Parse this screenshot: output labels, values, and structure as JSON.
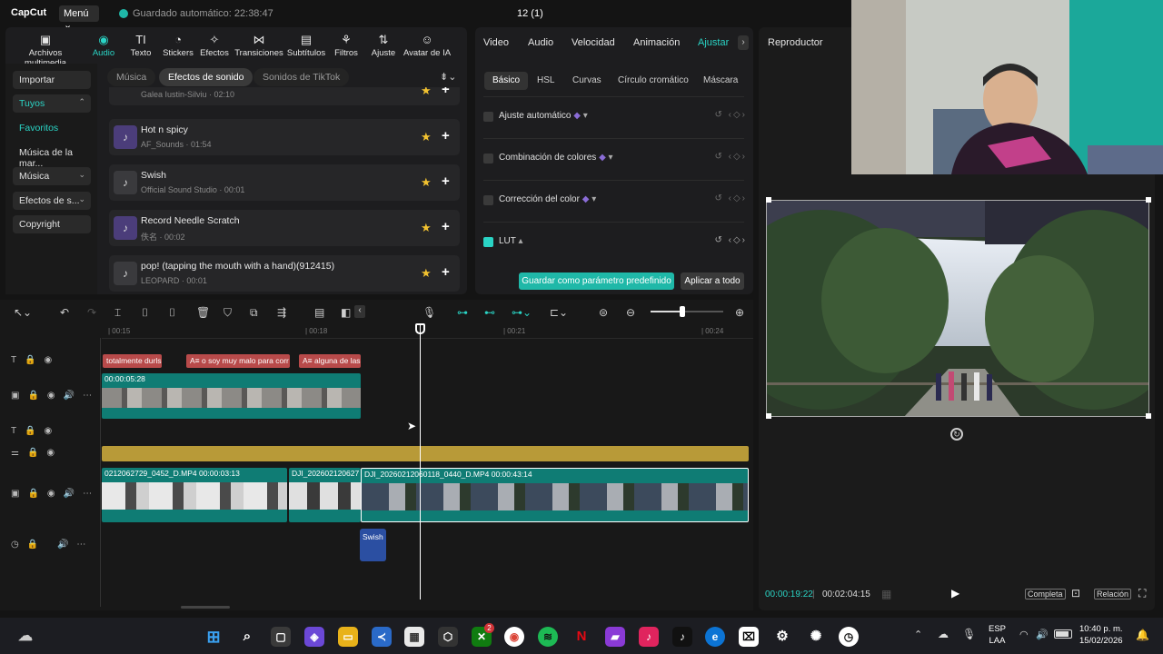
{
  "app": {
    "logo": "CapCut",
    "menu_label": "Menú ⌄",
    "autosave": "Guardado automático: 22:38:47",
    "project_title": "12 (1)"
  },
  "toolbar": [
    {
      "label": "Archivos multimedia",
      "icon": "media-icon"
    },
    {
      "label": "Audio",
      "icon": "audio-icon"
    },
    {
      "label": "Texto",
      "icon": "text-icon"
    },
    {
      "label": "Stickers",
      "icon": "sticker-icon"
    },
    {
      "label": "Efectos",
      "icon": "effects-icon"
    },
    {
      "label": "Transiciones",
      "icon": "transitions-icon"
    },
    {
      "label": "Subtítulos",
      "icon": "subtitles-icon"
    },
    {
      "label": "Filtros",
      "icon": "filters-icon"
    },
    {
      "label": "Ajuste",
      "icon": "adjust-icon"
    },
    {
      "label": "Avatar de IA",
      "icon": "ai-avatar-icon"
    }
  ],
  "categories": {
    "import": "Importar",
    "yours": "Tuyos",
    "favorites": "Favoritos",
    "brand_music": "Música de la mar...",
    "music": "Música",
    "sound_effects": "Efectos de s...",
    "copyright": "Copyright"
  },
  "subtabs": [
    "Música",
    "Efectos de sonido",
    "Sonidos de TikTok"
  ],
  "sounds": {
    "partial_sub": "Galea Iustin-Silviu · 02:10",
    "items": [
      {
        "name": "Hot n spicy",
        "sub": "AF_Sounds · 01:54"
      },
      {
        "name": "Swish",
        "sub": "Official Sound Studio · 00:01"
      },
      {
        "name": "Record Needle Scratch",
        "sub": "佚名 · 00:02"
      },
      {
        "name": "pop! (tapping the mouth with a hand)(912415)",
        "sub": "LEOPARD · 00:01"
      }
    ]
  },
  "adjust_panel": {
    "tabs": [
      "Video",
      "Audio",
      "Velocidad",
      "Animación",
      "Ajustar"
    ],
    "subtabs": [
      "Básico",
      "HSL",
      "Curvas",
      "Círculo cromático",
      "Máscara"
    ],
    "rows": [
      {
        "label": "Ajuste automático",
        "checked": false
      },
      {
        "label": "Combinación de colores",
        "checked": false
      },
      {
        "label": "Corrección del color",
        "checked": false
      },
      {
        "label": "LUT",
        "checked": true
      }
    ],
    "save_preset": "Guardar como parámetro predefinido",
    "apply_all": "Aplicar a todo"
  },
  "player": {
    "title": "Reproductor",
    "time_current": "00:00:19:22",
    "time_total": "00:02:04:15",
    "btn_full": "Completa",
    "btn_ratio": "Relación"
  },
  "timeline": {
    "ruler": [
      "| 00:15",
      "| 00:18",
      "| 00:21",
      "| 00:24"
    ],
    "captions": [
      "totalmente durls",
      "A≡ o soy muy malo para corr",
      "A≡ alguna de las"
    ],
    "overlay_clip_duration": "00:00:05:28",
    "main_clips": [
      {
        "label": "0212062729_0452_D.MP4   00:00:03:13"
      },
      {
        "label": "DJI_202602120627"
      },
      {
        "label": "DJI_20260212060118_0440_D.MP4   00:00:43:14"
      }
    ],
    "audio_clip": "Swish"
  },
  "taskbar": {
    "lang": "ESP",
    "lang2": "LAA",
    "time": "10:40 p. m.",
    "date": "15/02/2026",
    "xbox_badge": "2"
  },
  "colors": {
    "accent": "#2ad4c5",
    "caption": "#b84a4a",
    "video_clip": "#0f7c74",
    "effect_track": "#b89a38",
    "audio_clip": "#2b4fa2"
  }
}
